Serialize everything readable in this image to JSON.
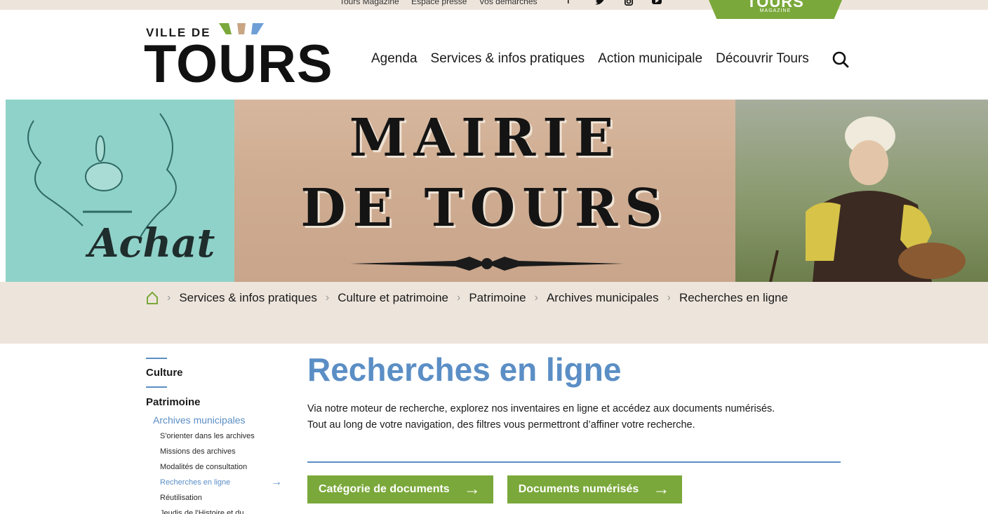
{
  "topbar": {
    "links": [
      "Tours Magazine",
      "Espace presse",
      "Vos démarches"
    ],
    "social_icons": [
      "facebook-icon",
      "twitter-icon",
      "instagram-icon",
      "youtube-icon"
    ],
    "magazine_badge": {
      "title": "TOURS",
      "subtitle": "MAGAZINE"
    }
  },
  "logo": {
    "line1": "VILLE DE",
    "line2": "TOURS"
  },
  "nav": {
    "items": [
      "Agenda",
      "Services & infos pratiques",
      "Action municipale",
      "Découvrir Tours"
    ],
    "search_icon": "search-icon"
  },
  "banner": {
    "title_line1": "MAIRIE",
    "title_line2": "DE TOURS",
    "left_caption": "Achat"
  },
  "breadcrumb": {
    "home_icon": "home-icon",
    "items": [
      "Services & infos pratiques",
      "Culture et patrimoine",
      "Patrimoine",
      "Archives municipales",
      "Recherches en ligne"
    ]
  },
  "sidebar": {
    "section": "Culture",
    "subsection": "Patrimoine",
    "current_group": "Archives municipales",
    "items": [
      "S'orienter dans les archives",
      "Missions des archives",
      "Modalités de consultation",
      "Recherches en ligne",
      "Réutilisation",
      "Jeudis de l'Histoire et du"
    ],
    "active_index": 3
  },
  "main": {
    "title": "Recherches en ligne",
    "intro_line1": "Via notre moteur de recherche, explorez nos inventaires en ligne et accédez aux documents numérisés.",
    "intro_line2": "Tout au long de votre navigation, des filtres vous permettront d’affiner votre recherche.",
    "buttons": [
      "Catégorie de documents",
      "Documents numérisés"
    ]
  },
  "colors": {
    "accent_blue": "#5b8ec5",
    "brand_green": "#7aa83a",
    "beige": "#ede5dc"
  }
}
